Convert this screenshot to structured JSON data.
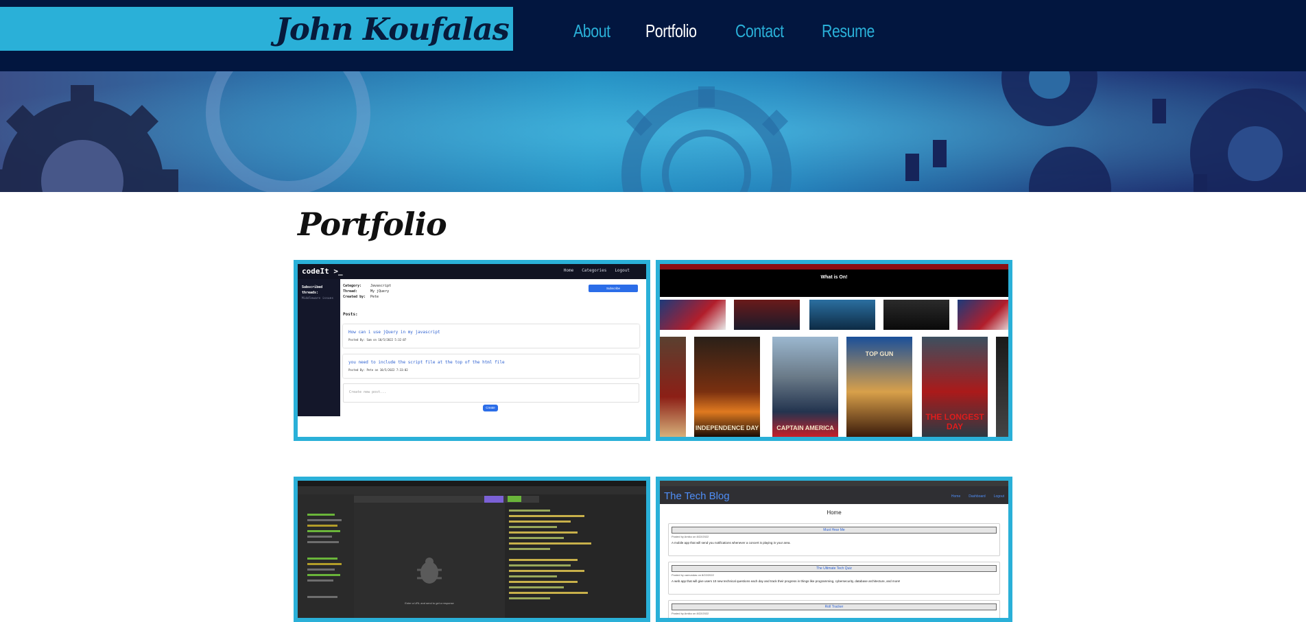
{
  "header": {
    "brand": "John Koufalas",
    "nav": [
      {
        "label": "About",
        "active": false
      },
      {
        "label": "Portfolio",
        "active": true
      },
      {
        "label": "Contact",
        "active": false
      },
      {
        "label": "Resume",
        "active": false
      }
    ]
  },
  "colors": {
    "navy": "#02163f",
    "accent": "#2ab0d8",
    "active_nav": "#ffffff"
  },
  "main": {
    "title": "Portfolio"
  },
  "projects": {
    "codeit": {
      "logo": "codeIt >_",
      "nav": [
        "Home",
        "Categories",
        "Logout"
      ],
      "sidebar_title": "Subscribed threads:",
      "sidebar_item": "Middleware issues",
      "meta_labels": [
        "Category:",
        "Thread:",
        "Created by:"
      ],
      "meta_values": [
        "Javascript",
        "My jQuery",
        "Pete"
      ],
      "subscribe_button": "Subscribe",
      "posts_label": "Posts:",
      "posts": [
        {
          "text": "How can i use jQuery in my javascript",
          "meta": "Posted By: Sam on 10/5/2022 5:32:07"
        },
        {
          "text": "you need to include the script file at the top of the html file",
          "meta": "Posted By: Pete on 10/5/2022 7:33:02"
        }
      ],
      "new_post_placeholder": "Create new post...",
      "create_button": "Create"
    },
    "movies": {
      "heading": "What is On!",
      "posters": [
        "INDEPENDENCE DAY",
        "CAPTAIN AMERICA",
        "TOP GUN",
        "THE LONGEST DAY"
      ]
    },
    "insomnia": {
      "empty_message": "Enter a URL and send to get a response"
    },
    "techblog": {
      "title": "The Tech Blog",
      "nav": [
        "Home",
        "Dashboard",
        "Logout"
      ],
      "home_label": "Home",
      "posts": [
        {
          "title": "Must Hear Me",
          "author": "Posted by Amiko on 8/22/2022",
          "description": "A mobile app that will send you notifications whenever a concert is playing in your area."
        },
        {
          "title": "The Ultimate Tech Quiz",
          "author": "Posted by camundas on 8/22/2022",
          "description": "A web app that will give users 10 new technical questions each day and track their progress in things like programming, cybersecurity, database architecture, and more!"
        },
        {
          "title": "Roll Tracker",
          "author": "Posted by Amiko on 8/22/2022",
          "description": ""
        }
      ]
    }
  }
}
